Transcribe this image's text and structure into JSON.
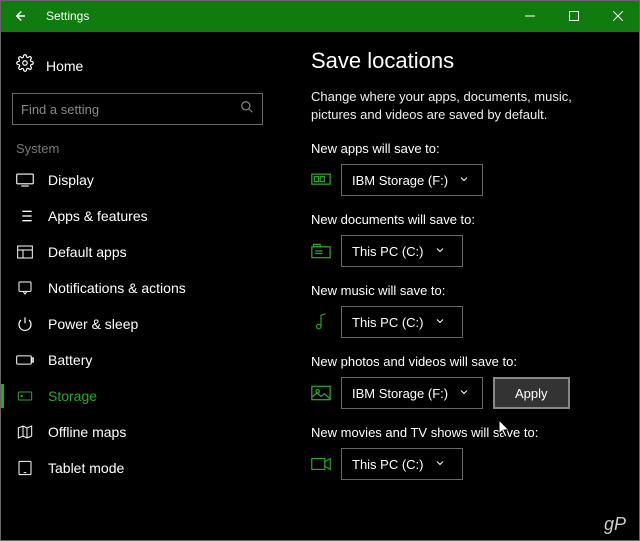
{
  "titlebar": {
    "title": "Settings"
  },
  "sidebar": {
    "home": "Home",
    "search_placeholder": "Find a setting",
    "category": "System",
    "items": [
      {
        "label": "Display"
      },
      {
        "label": "Apps & features"
      },
      {
        "label": "Default apps"
      },
      {
        "label": "Notifications & actions"
      },
      {
        "label": "Power & sleep"
      },
      {
        "label": "Battery"
      },
      {
        "label": "Storage",
        "active": true
      },
      {
        "label": "Offline maps"
      },
      {
        "label": "Tablet mode"
      }
    ]
  },
  "main": {
    "heading": "Save locations",
    "description": "Change where your apps, documents, music, pictures and videos are saved by default.",
    "settings": {
      "apps": {
        "label": "New apps will save to:",
        "value": "IBM Storage (F:)"
      },
      "docs": {
        "label": "New documents will save to:",
        "value": "This PC (C:)"
      },
      "music": {
        "label": "New music will save to:",
        "value": "This PC (C:)"
      },
      "photos": {
        "label": "New photos and videos will save to:",
        "value": "IBM Storage (F:)",
        "apply": "Apply"
      },
      "movies": {
        "label": "New movies and TV shows will save to:",
        "value": "This PC (C:)"
      }
    }
  },
  "watermark": "gP",
  "colors": {
    "accent": "#107c10",
    "accent_light": "#2aa82a",
    "border": "#666"
  }
}
